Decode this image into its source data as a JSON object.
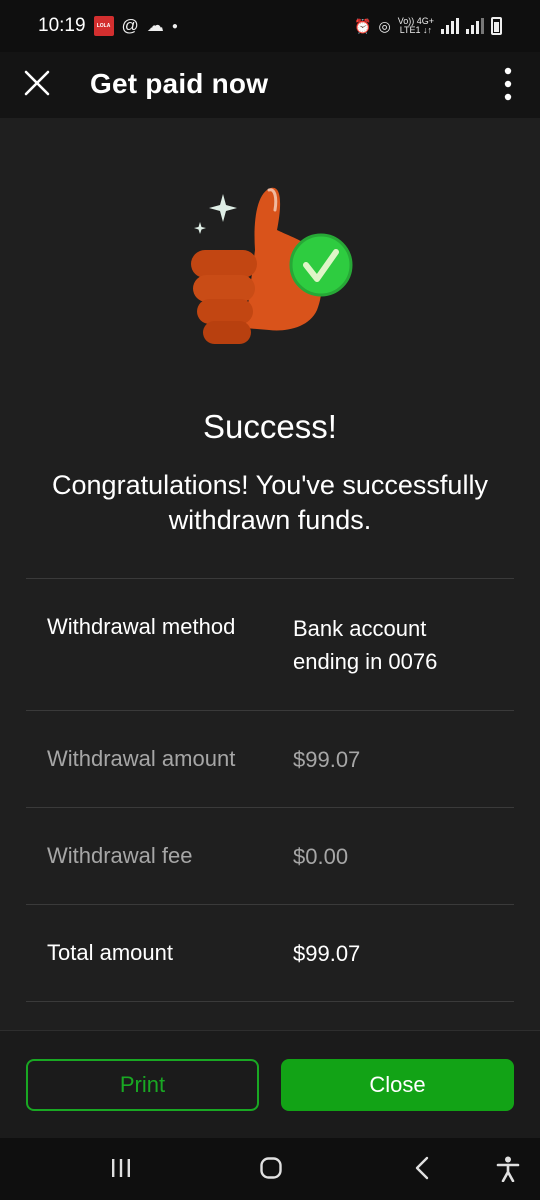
{
  "status_bar": {
    "time": "10:19",
    "app_badge": "LOLA",
    "network_line1": "Vo)) 4G+",
    "network_line2": "LTE1 ↓↑"
  },
  "header": {
    "title": "Get paid now"
  },
  "result": {
    "title": "Success!",
    "message": "Congratulations! You've successfully withdrawn funds."
  },
  "details": {
    "rows": [
      {
        "label": "Withdrawal method",
        "value": "Bank account ending in 0076"
      },
      {
        "label": "Withdrawal amount",
        "value": "$99.07"
      },
      {
        "label": "Withdrawal fee",
        "value": "$0.00"
      },
      {
        "label": "Total amount",
        "value": "$99.07"
      }
    ]
  },
  "actions": {
    "print_label": "Print",
    "close_label": "Close"
  },
  "icons": {
    "close": "close-icon",
    "more": "more-vertical-icon",
    "hero": "thumbs-up-check-illustration",
    "nav_recents": "recents-icon",
    "nav_home": "home-icon",
    "nav_back": "back-icon",
    "nav_accessibility": "accessibility-icon"
  },
  "colors": {
    "background": "#1f1f1f",
    "accent_green": "#12a316",
    "thumb_orange": "#d9531b",
    "check_green": "#2ecc40"
  }
}
